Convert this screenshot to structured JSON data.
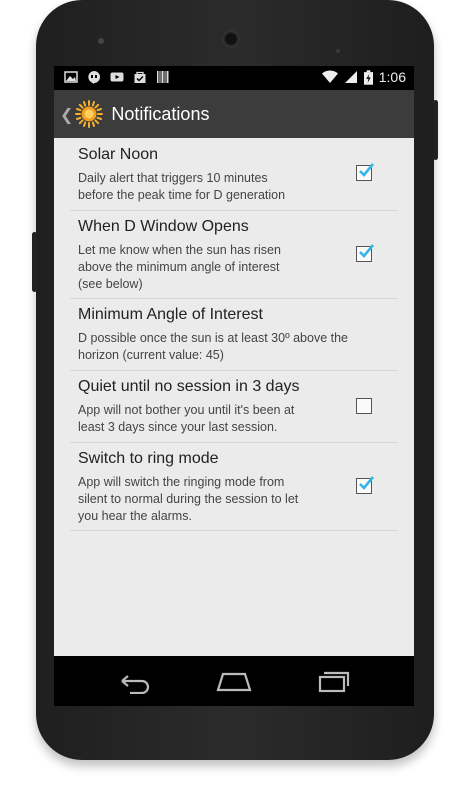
{
  "statusbar": {
    "time": "1:06",
    "left_icons": [
      "image-icon",
      "hangouts-icon",
      "youtube-icon",
      "bag-check-icon",
      "barcode-icon"
    ],
    "right_icons": [
      "wifi-icon",
      "signal-icon",
      "battery-charging-icon"
    ]
  },
  "actionbar": {
    "back_glyph": "❮",
    "title": "Notifications",
    "logo_icon": "sun-logo-icon",
    "color": "#3c3c3c"
  },
  "accent_color": "#33b5e5",
  "preferences": [
    {
      "title": "Solar Noon",
      "summary_lines": [
        "Daily alert that triggers 10 minutes",
        "before the peak time for D generation"
      ],
      "checkbox": true,
      "checked": true
    },
    {
      "title": "When D Window Opens",
      "summary_lines": [
        "Let me know when the sun has risen",
        "above the minimum angle of interest",
        "(see below)"
      ],
      "checkbox": true,
      "checked": true
    },
    {
      "title": "Minimum Angle of Interest",
      "summary_lines": [
        "D possible once the sun is at least 30º above the",
        "horizon (current value: 45)"
      ],
      "checkbox": false,
      "checked": false
    },
    {
      "title": "Quiet until no session in 3 days",
      "summary_lines": [
        "App will not bother you until it's been at",
        "least 3 days since your last session."
      ],
      "checkbox": true,
      "checked": false
    },
    {
      "title": "Switch to ring mode",
      "summary_lines": [
        "App will switch the ringing mode from",
        "silent to normal during the session to let",
        "you hear the alarms."
      ],
      "checkbox": true,
      "checked": true
    }
  ],
  "navbar": {
    "buttons": [
      "back-icon",
      "home-icon",
      "recents-icon"
    ]
  }
}
